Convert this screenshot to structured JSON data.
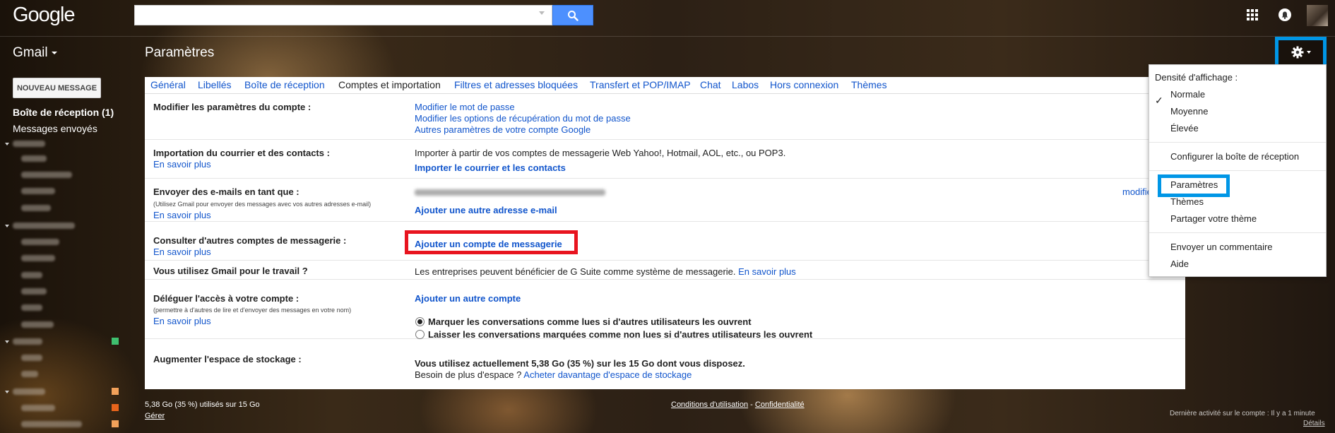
{
  "header": {
    "logo": "Google",
    "search": {
      "value": "",
      "placeholder": ""
    }
  },
  "subheader": {
    "app": "Gmail",
    "page_title": "Paramètres"
  },
  "sidebar": {
    "compose": "NOUVEAU MESSAGE",
    "inbox": "Boîte de réception (1)",
    "sent": "Messages envoyés"
  },
  "tabs": [
    "Général",
    "Libellés",
    "Boîte de réception",
    "Comptes et importation",
    "Filtres et adresses bloquées",
    "Transfert et POP/IMAP",
    "Chat",
    "Labos",
    "Hors connexion",
    "Thèmes"
  ],
  "active_tab": "Comptes et importation",
  "settings": {
    "account": {
      "label": "Modifier les paramètres du compte :",
      "links": [
        "Modifier le mot de passe",
        "Modifier les options de récupération du mot de passe",
        "Autres paramètres de votre compte Google"
      ]
    },
    "import": {
      "label": "Importation du courrier et des contacts :",
      "learn": "En savoir plus",
      "text": "Importer à partir de vos comptes de messagerie Web Yahoo!, Hotmail, AOL, etc., ou POP3.",
      "link": "Importer le courrier et les contacts"
    },
    "send_as": {
      "label": "Envoyer des e-mails en tant que :",
      "note": "(Utilisez Gmail pour envoyer des messages avec vos autres adresses e-mail)",
      "learn": "En savoir plus",
      "link": "Ajouter une autre adresse e-mail",
      "edit": "modifie"
    },
    "other_accounts": {
      "label": "Consulter d'autres comptes de messagerie :",
      "learn": "En savoir plus",
      "link": "Ajouter un compte de messagerie"
    },
    "work": {
      "label": "Vous utilisez Gmail pour le travail ?",
      "text": "Les entreprises peuvent bénéficier de G Suite comme système de messagerie.",
      "learn": "En savoir plus"
    },
    "delegate": {
      "label": "Déléguer l'accès à votre compte :",
      "note": "(permettre à d'autres de lire et d'envoyer des messages en votre nom)",
      "learn": "En savoir plus",
      "link": "Ajouter un autre compte",
      "option1": "Marquer les conversations comme lues si d'autres utilisateurs les ouvrent",
      "option2": "Laisser les conversations marquées comme non lues si d'autres utilisateurs les ouvrent"
    },
    "storage": {
      "label": "Augmenter l'espace de stockage :",
      "usage": "Vous utilisez actuellement 5,38 Go (35 %) sur les 15 Go dont vous disposez.",
      "need": "Besoin de plus d'espace ?",
      "link": "Acheter davantage d'espace de stockage"
    }
  },
  "footer": {
    "usage": "5,38 Go (35 %) utilisés sur 15 Go",
    "manage": "Gérer",
    "terms": "Conditions d'utilisation",
    "separator": "-",
    "privacy": "Confidentialité",
    "activity": "Dernière activité sur le compte : Il y a 1 minute",
    "details": "Détails"
  },
  "menu": {
    "density_header": "Densité d'affichage :",
    "normal": "Normale",
    "medium": "Moyenne",
    "high": "Élevée",
    "configure_inbox": "Configurer la boîte de réception",
    "settings": "Paramètres",
    "themes": "Thèmes",
    "share_theme": "Partager votre thème",
    "feedback": "Envoyer un commentaire",
    "help": "Aide"
  },
  "colors": {
    "link": "#1155cc",
    "search_button": "#4d90fe",
    "highlight_blue": "#0096e6",
    "highlight_red": "#e8141f"
  }
}
